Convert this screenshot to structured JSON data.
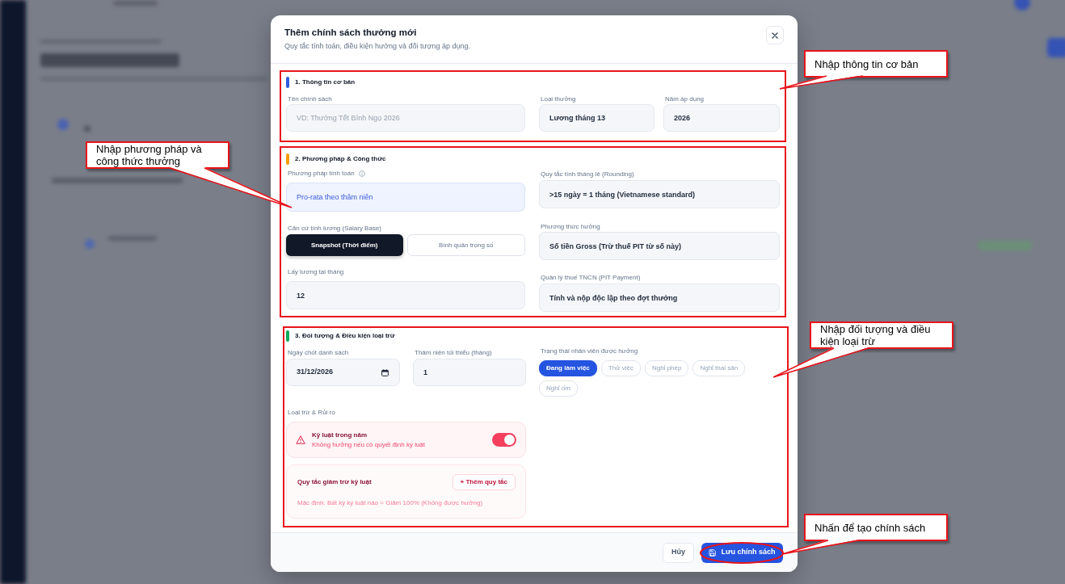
{
  "dialog": {
    "title": "Thêm chính sách thưởng mới",
    "subtitle": "Quy tắc tính toán, điều kiện hưởng và đối tượng áp dụng."
  },
  "sections": [
    {
      "kind": "basic",
      "title": "1. Thông tin cơ bản",
      "color": "#2f5ae0",
      "fields": [
        {
          "label": "Tên chính sách",
          "placeholder": "VD: Thưởng Tết Bính Ngọ 2026"
        },
        {
          "label": "Loại thưởng",
          "value": "Lương tháng 13"
        },
        {
          "label": "Năm áp dụng",
          "value": "2026"
        }
      ]
    },
    {
      "kind": "method",
      "title": "2. Phương pháp & Công thức",
      "color": "#f59e0b",
      "left": [
        {
          "kind": "highlight",
          "label": "Phương pháp tính toán",
          "info": true,
          "value": "Pro-rata theo thâm niên"
        },
        {
          "kind": "segmented",
          "label": "Căn cứ tính lương (Salary Base)",
          "options": [
            {
              "label": "Snapshot (Thời điểm)",
              "selected": true
            },
            {
              "label": "Bình quân trọng số",
              "selected": false
            }
          ]
        },
        {
          "kind": "text",
          "label": "Lấy lương tại tháng",
          "value": "12"
        }
      ],
      "right": [
        {
          "kind": "text",
          "label": "Quy tắc tính tháng lẻ (Rounding)",
          "value": ">15 ngày = 1 tháng (Vietnamese standard)"
        },
        {
          "kind": "text",
          "label": "Phương thức hưởng",
          "value": "Số tiền Gross (Trừ thuế PIT từ số này)"
        },
        {
          "kind": "text",
          "label": "Quản lý thuế TNCN (PIT Payment)",
          "value": "Tính và nộp độc lập theo đợt thưởng"
        }
      ]
    },
    {
      "kind": "eligibility",
      "title": "3. Đối tượng & Điều kiện loại trừ",
      "color": "#10a95b",
      "fields": [
        {
          "kind": "date",
          "label": "Ngày chốt danh sách",
          "value": "31/12/2026"
        },
        {
          "kind": "text",
          "label": "Thâm niên tối thiểu (tháng)",
          "value": "1"
        }
      ],
      "status": {
        "label": "Trạng thái nhân viên được hưởng",
        "options": [
          {
            "label": "Đang làm việc",
            "selected": true
          },
          {
            "label": "Thử việc",
            "selected": false
          },
          {
            "label": "Nghỉ phép",
            "selected": false
          },
          {
            "label": "Nghỉ thai sản",
            "selected": false
          },
          {
            "label": "Nghỉ ốm",
            "selected": false
          }
        ]
      },
      "exclusions": {
        "label": "Loại trừ & Rủi ro",
        "rule": {
          "title": "Kỷ luật trong năm",
          "description": "Không hưởng nếu có quyết định kỷ luật",
          "on": true
        },
        "deductions": {
          "title": "Quy tắc giảm trừ kỷ luật",
          "button": "+ Thêm quy tắc",
          "note": "Mặc định: Bất kỳ kỷ luật nào = Giảm 100% (Không được hưởng)"
        }
      }
    }
  ],
  "footer": {
    "buttons": [
      {
        "kind": "secondary",
        "label": "Hủy"
      },
      {
        "kind": "primary",
        "label": "Lưu chính sách"
      }
    ]
  },
  "annotations": [
    {
      "kind": "frame",
      "text": "Nhập thông tin cơ bản"
    },
    {
      "kind": "frame",
      "text": "Nhập phương pháp và công thức thưởng"
    },
    {
      "kind": "frame",
      "text": "Nhập đối tượng và điều kiện loại trừ"
    },
    {
      "kind": "ellipse",
      "text": "Nhấn để tạo chính sách"
    }
  ]
}
